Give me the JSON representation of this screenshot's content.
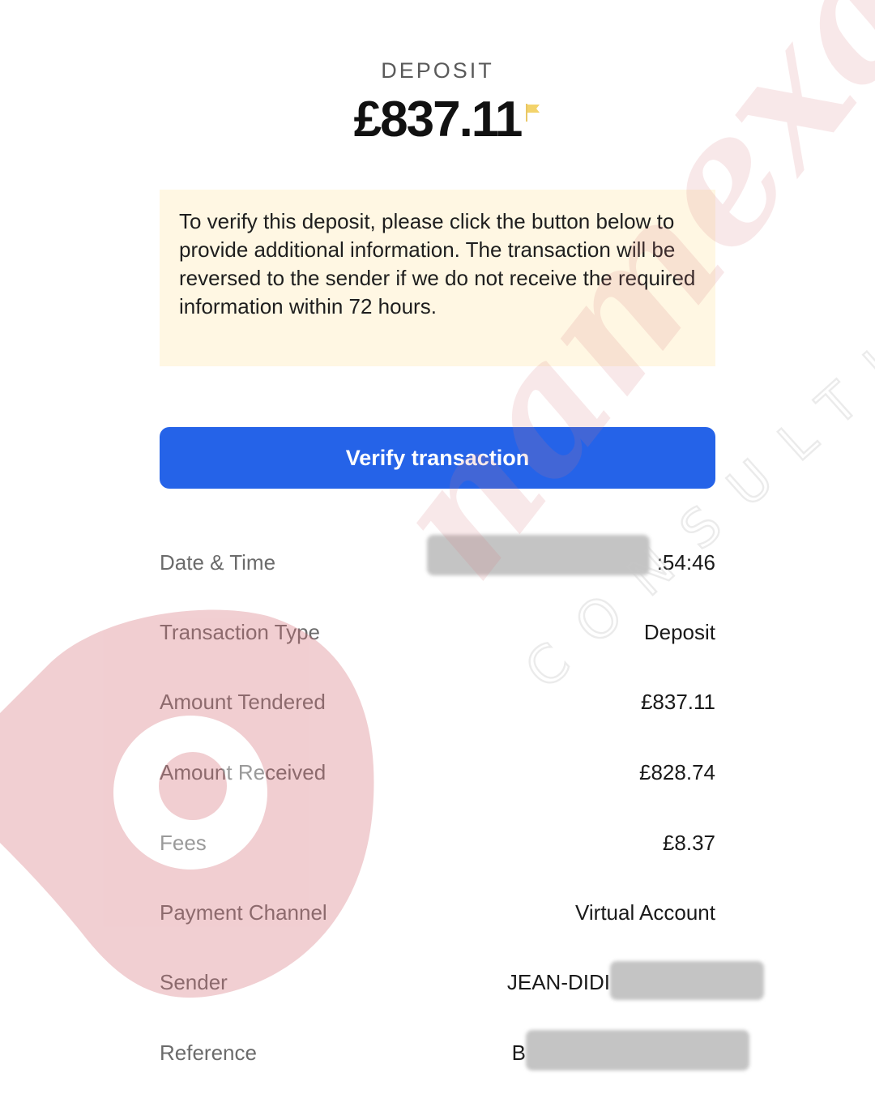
{
  "header": {
    "label": "DEPOSIT",
    "amount": "£837.11"
  },
  "notice": {
    "text": "To verify this deposit, please click the button below to provide additional information. The transaction will be reversed to the sender if we do not receive the required information within 72 hours."
  },
  "verify_button": {
    "label": "Verify transaction"
  },
  "details": {
    "date_time": {
      "label": "Date & Time",
      "value": ":54:46"
    },
    "transaction_type": {
      "label": "Transaction Type",
      "value": "Deposit"
    },
    "amount_tendered": {
      "label": "Amount Tendered",
      "value": "£837.11"
    },
    "amount_received": {
      "label": "Amount Received",
      "value": "£828.74"
    },
    "fees": {
      "label": "Fees",
      "value": "£8.37"
    },
    "payment_channel": {
      "label": "Payment Channel",
      "value": "Virtual Account"
    },
    "sender": {
      "label": "Sender",
      "value": "JEAN-DIDI"
    },
    "reference": {
      "label": "Reference",
      "value": "B"
    }
  },
  "watermark": {
    "brand": "namexa",
    "tagline": "CONSULTING"
  },
  "colors": {
    "accent_blue": "#2563e8",
    "notice_bg": "#fff7e3",
    "flag": "#f3d36b",
    "watermark": "#d9777d"
  },
  "icons": {
    "flag": "flag-icon"
  }
}
